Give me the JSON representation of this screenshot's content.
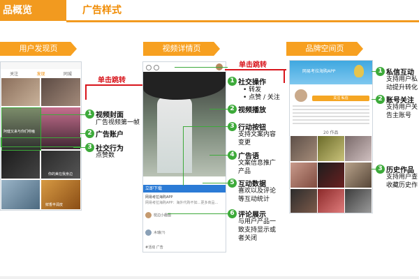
{
  "header": {
    "left_title": "品概览",
    "right_title": "广告样式"
  },
  "colors": {
    "orange": "#f29a1f",
    "green": "#3daa3a",
    "red": "#d8141b"
  },
  "sections": {
    "user_discovery": "用户发现页",
    "video_detail": "视频详情页",
    "brand_space": "品牌空间页"
  },
  "jumps": {
    "first": "单击跳转",
    "second": "单击跳转"
  },
  "screen1": {
    "tabs": [
      "关注",
      "发现",
      "同城"
    ],
    "overlay_text": "阿健又来与你们唠嗑",
    "caption": "你的美在我身边",
    "food_caption": "鲜香丰润皮"
  },
  "screen2": {
    "cta_label": "立即下载",
    "account": "网易考拉海购APP",
    "ad_copy": "网易考拉海购APP：海外代购不如…更多商品…",
    "comment_user_1": "枕边小趣图",
    "comment_user_2": "木瑞(?)",
    "tags": "#活动 广告"
  },
  "screen3": {
    "app_name": "网易考拉海购APP",
    "tab": "20 作品",
    "follow_bar": "关注 私信"
  },
  "annotations_left": [
    {
      "num": "1",
      "title": "视频封面",
      "desc": "广告视频第一帧"
    },
    {
      "num": "2",
      "title": "广告账户",
      "desc": ""
    },
    {
      "num": "3",
      "title": "社交行为",
      "desc": "点赞数"
    }
  ],
  "annotations_mid": [
    {
      "num": "1",
      "title": "社交操作",
      "bullets": [
        "转发",
        "点赞 / 关注"
      ]
    },
    {
      "num": "2",
      "title": "视频播放",
      "desc": ""
    },
    {
      "num": "3",
      "title": "行动按钮",
      "desc_lines": [
        "支持文案内容",
        "变更"
      ]
    },
    {
      "num": "4",
      "title": "广告语",
      "desc_lines": [
        "文案信息推广",
        "产品"
      ]
    },
    {
      "num": "5",
      "title": "互动数据",
      "desc_lines": [
        "喜欢以及评论",
        "等互动统计"
      ]
    },
    {
      "num": "6",
      "title": "评论展示",
      "desc_lines": [
        "与用户产品一",
        "致支持显示或",
        "者关闭"
      ]
    }
  ],
  "annotations_right": [
    {
      "num": "1",
      "title": "私信互动",
      "desc_lines": [
        "支持用户私",
        "动提升转化"
      ]
    },
    {
      "num": "2",
      "title": "账号关注",
      "desc_lines": [
        "支持用户关",
        "告主账号"
      ]
    },
    {
      "num": "3",
      "title": "历史作品",
      "desc_lines": [
        "支持用户查",
        "收藏历史作"
      ]
    }
  ]
}
